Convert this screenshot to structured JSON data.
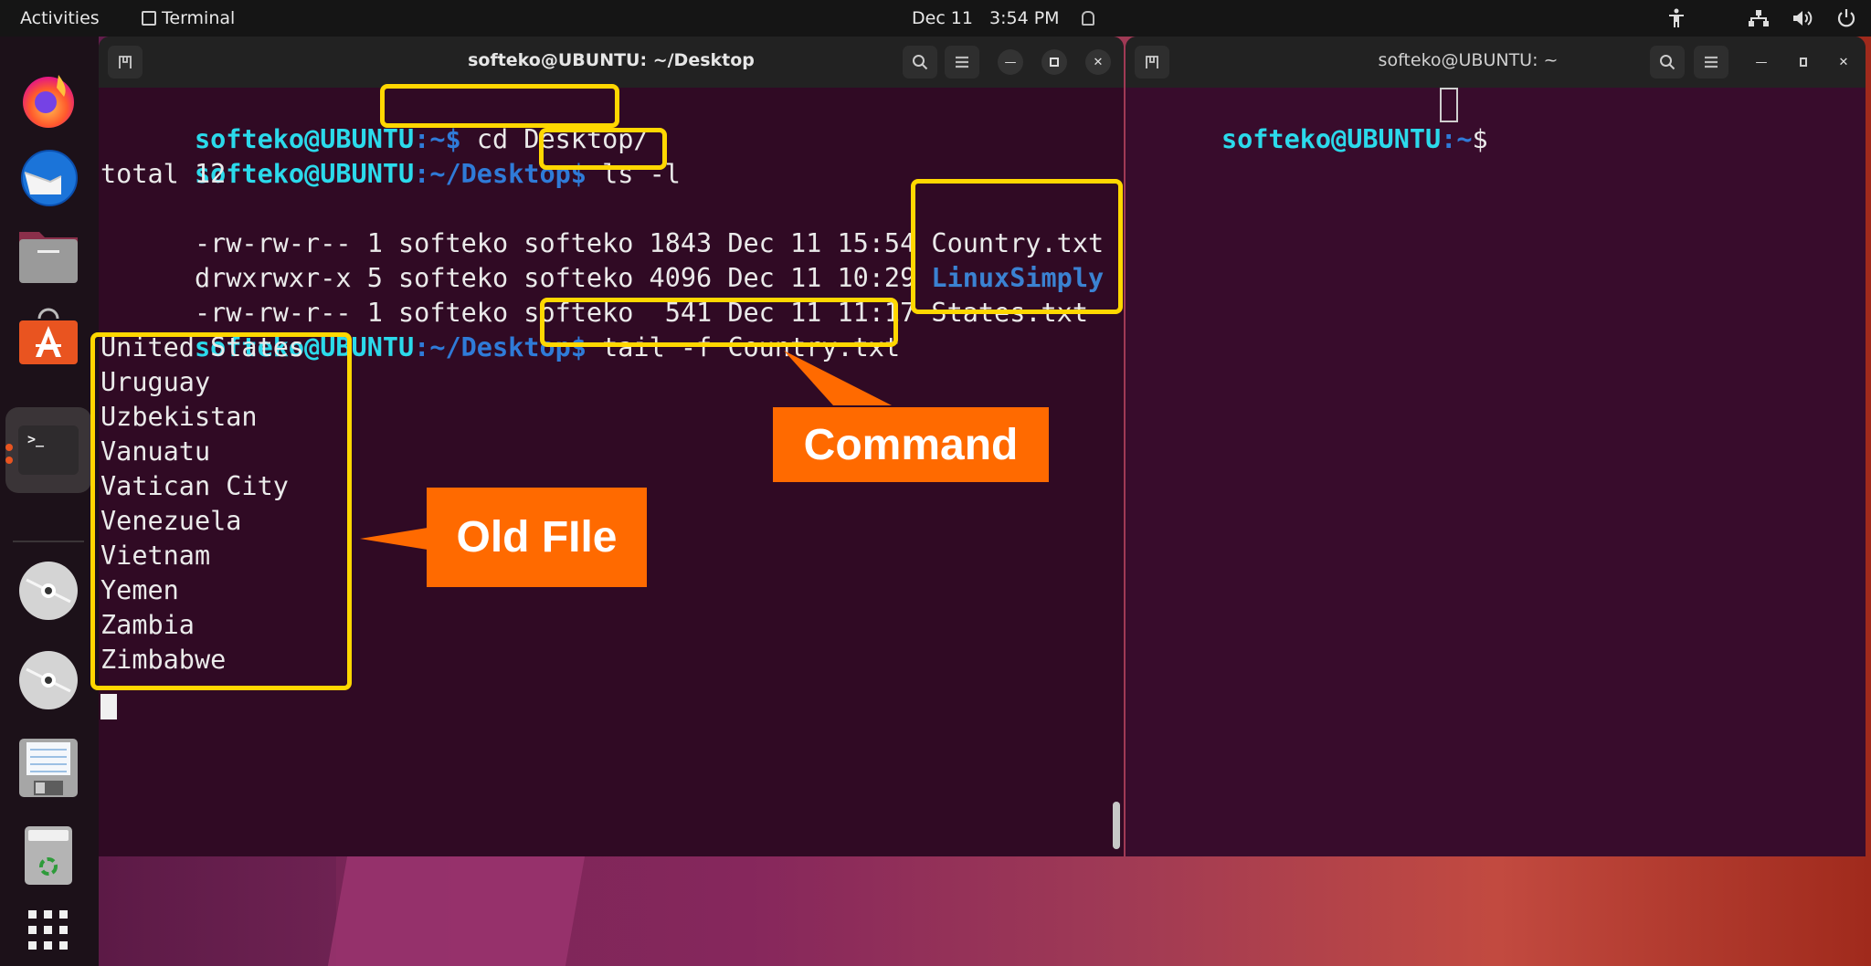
{
  "topbar": {
    "activities": "Activities",
    "app_name": "Terminal",
    "date": "Dec 11",
    "time": "3:54 PM",
    "tray_icons": [
      "accessibility-icon",
      "network-icon",
      "volume-icon",
      "power-icon"
    ]
  },
  "dock": {
    "items": [
      {
        "name": "Firefox",
        "icon": "firefox-icon"
      },
      {
        "name": "Thunderbird",
        "icon": "thunderbird-icon"
      },
      {
        "name": "Files",
        "icon": "files-icon"
      },
      {
        "name": "Ubuntu Software",
        "icon": "app-store-icon"
      },
      {
        "name": "Terminal",
        "icon": "terminal-icon",
        "active": true
      },
      {
        "name": "Disc 1",
        "icon": "disc-icon"
      },
      {
        "name": "Disc 2",
        "icon": "disc-icon"
      },
      {
        "name": "Save",
        "icon": "floppy-icon"
      },
      {
        "name": "Trash",
        "icon": "trash-icon"
      },
      {
        "name": "Show Applications",
        "icon": "app-grid-icon"
      }
    ]
  },
  "left_terminal": {
    "title": "softeko@UBUNTU: ~/Desktop",
    "lines": [
      {
        "user": "softeko@UBUNTU",
        "path": ":~",
        "sym": "$",
        "cmd": " cd Desktop/"
      },
      {
        "user": "softeko@UBUNTU",
        "path": ":~/Desktop",
        "sym": "$",
        "cmd": " ls -l"
      },
      {
        "text": "total 12"
      },
      {
        "text": "-rw-rw-r-- 1 softeko softeko 1843 Dec 11 15:54 ",
        "file": "Country.txt"
      },
      {
        "text": "drwxrwxr-x 5 softeko softeko 4096 Dec 11 10:29 ",
        "dir": "LinuxSimply"
      },
      {
        "text": "-rw-rw-r-- 1 softeko softeko  541 Dec 11 11:17 ",
        "file": "States.txt"
      },
      {
        "user": "softeko@UBUNTU",
        "path": ":~/Desktop",
        "sym": "$",
        "cmd": " tail -f Country.txt"
      }
    ],
    "output": [
      "United States",
      "Uruguay",
      "Uzbekistan",
      "Vanuatu",
      "Vatican City",
      "Venezuela",
      "Vietnam",
      "Yemen",
      "Zambia",
      "Zimbabwe"
    ]
  },
  "right_terminal": {
    "title": "softeko@UBUNTU: ~",
    "prompt_user": "softeko@UBUNTU",
    "prompt_path": ":~",
    "prompt_sym": "$ "
  },
  "annotations": {
    "command_label": "Command",
    "old_file_label": "Old FIle",
    "highlight_color": "#ffd700",
    "callout_color": "#ff6a00"
  }
}
